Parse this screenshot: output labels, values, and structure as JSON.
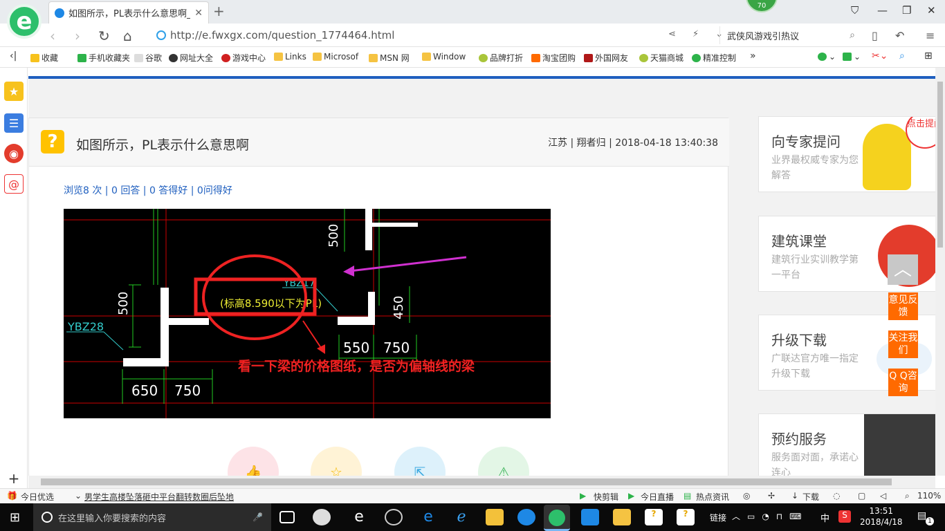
{
  "browser": {
    "tab_title": "如图所示，PL表示什么意思啊_广",
    "badge": "70",
    "url": "http://e.fwxgx.com/question_1774464.html",
    "search_text": "武侠风游戏引热议"
  },
  "bookmarks": [
    "收藏",
    "手机收藏夹",
    "谷歌",
    "网址大全",
    "游戏中心",
    "Links",
    "Microsof",
    "MSN 网",
    "Window",
    "品牌打折",
    "淘宝团购",
    "外国网友",
    "天猫商城",
    "精准控制"
  ],
  "question": {
    "title": "如图所示，PL表示什么意思啊",
    "meta": "江苏 | 翔者归 | 2018-04-18 13:40:38",
    "stats": "浏览8 次 | 0 回答 | 0 答得好 | 0问得好"
  },
  "drawing": {
    "label_pl": "(标高8.590以下为PL)",
    "label_ybz17": "YBZ17",
    "label_ybz28": "YBZ28",
    "dim_500a": "500",
    "dim_500b": "500",
    "dim_450": "450",
    "dim_550": "550",
    "dim_750a": "750",
    "dim_650": "650",
    "dim_750b": "750",
    "annotation": "看一下梁的价格图纸，是否为偏轴线的梁"
  },
  "right_cards": [
    {
      "title": "向专家提问",
      "sub": "业界最权威专家为您解答"
    },
    {
      "title": "建筑课堂",
      "sub": "建筑行业实训教学第一平台"
    },
    {
      "title": "升级下载",
      "sub": "广联达官方唯一指定升级下载"
    },
    {
      "title": "预约服务",
      "sub": "服务面对面，承诺心连心"
    }
  ],
  "float_buttons": {
    "feedback": "意见反馈",
    "follow": "关注我们",
    "qq": "Q Q咨询",
    "bubble": "点击提问"
  },
  "statusbar": {
    "today": "今日优选",
    "news": "男学生高楼坠落砸中平台翻转数圈后坠地",
    "clip": "快剪辑",
    "live": "今日直播",
    "hot": "热点资讯",
    "download": "下载",
    "zoom": "110%"
  },
  "taskbar": {
    "search_placeholder": "在这里输入你要搜索的内容",
    "link": "链接",
    "ime": "中",
    "time": "13:51",
    "date": "2018/4/18",
    "notif": "1"
  }
}
